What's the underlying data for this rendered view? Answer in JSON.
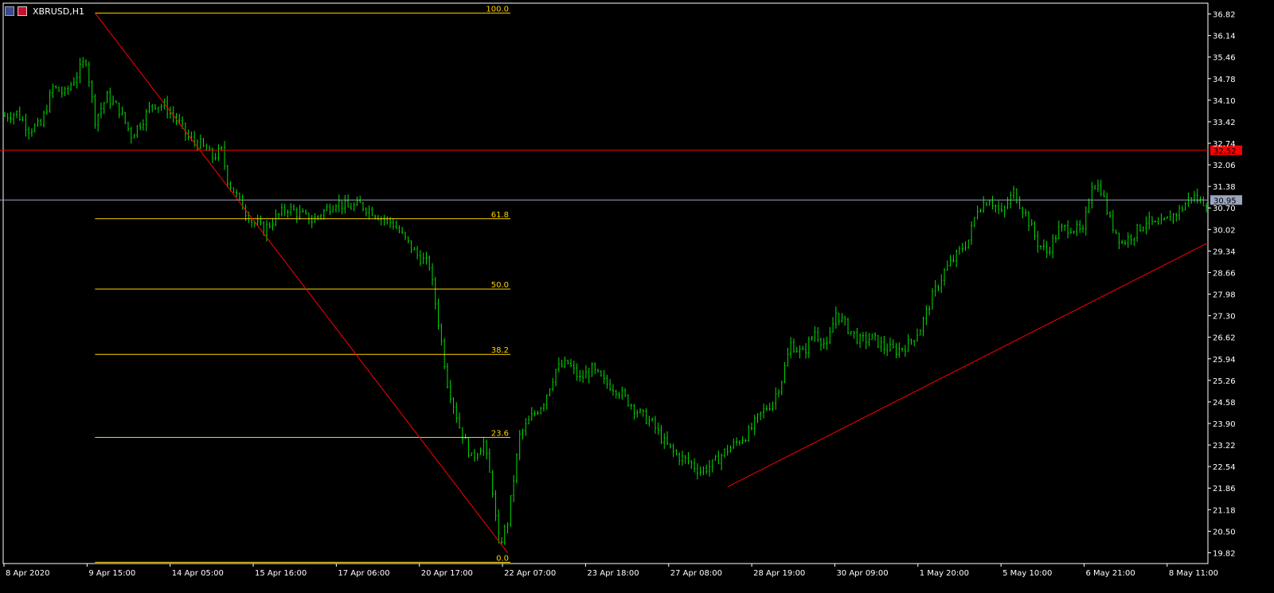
{
  "window": {
    "symbol_title": "XBRUSD,H1",
    "icons": [
      "window-menu-icon",
      "flag-icon"
    ]
  },
  "colors": {
    "background": "#000000",
    "candle": "#00e000",
    "fib_level": "#ffd400",
    "trendline": "#ff0000",
    "resistance": "#ff0000",
    "bid_line": "#9aa6c0",
    "axis": "#ffffff"
  },
  "chart_data": {
    "type": "candlestick",
    "symbol": "XBRUSD",
    "timeframe": "H1",
    "ylim": [
      19.48,
      37.16
    ],
    "price_ticks": [
      "36.82",
      "36.14",
      "35.46",
      "34.78",
      "34.10",
      "33.42",
      "32.74",
      "32.06",
      "31.38",
      "30.70",
      "30.02",
      "29.34",
      "28.66",
      "27.98",
      "27.30",
      "26.62",
      "25.94",
      "25.26",
      "24.58",
      "23.90",
      "23.22",
      "22.54",
      "21.86",
      "21.18",
      "20.50",
      "19.82"
    ],
    "time_ticks": [
      "8 Apr 2020",
      "9 Apr 15:00",
      "14 Apr 05:00",
      "15 Apr 16:00",
      "17 Apr 06:00",
      "20 Apr 17:00",
      "22 Apr 07:00",
      "23 Apr 18:00",
      "27 Apr 08:00",
      "28 Apr 19:00",
      "30 Apr 09:00",
      "1 May 20:00",
      "5 May 10:00",
      "6 May 21:00",
      "8 May 11:00"
    ],
    "path": [
      [
        0,
        33.6
      ],
      [
        4,
        33.7
      ],
      [
        8,
        33.2
      ],
      [
        12,
        33.3
      ],
      [
        16,
        34.5
      ],
      [
        20,
        34.3
      ],
      [
        24,
        34.9
      ],
      [
        27,
        35.4
      ],
      [
        30,
        33.5
      ],
      [
        34,
        34.2
      ],
      [
        38,
        33.8
      ],
      [
        42,
        33.0
      ],
      [
        46,
        33.5
      ],
      [
        49,
        34.0
      ],
      [
        53,
        33.9
      ],
      [
        57,
        33.5
      ],
      [
        61,
        32.9
      ],
      [
        65,
        32.7
      ],
      [
        69,
        32.3
      ],
      [
        72,
        32.5
      ],
      [
        74,
        31.6
      ],
      [
        78,
        30.9
      ],
      [
        82,
        30.3
      ],
      [
        86,
        30.0
      ],
      [
        90,
        30.4
      ],
      [
        94,
        30.7
      ],
      [
        98,
        30.5
      ],
      [
        102,
        30.3
      ],
      [
        106,
        30.6
      ],
      [
        110,
        30.9
      ],
      [
        114,
        30.7
      ],
      [
        118,
        30.8
      ],
      [
        122,
        30.6
      ],
      [
        125,
        30.4
      ],
      [
        129,
        30.2
      ],
      [
        133,
        29.7
      ],
      [
        137,
        29.2
      ],
      [
        141,
        28.9
      ],
      [
        144,
        27.1
      ],
      [
        147,
        25.2
      ],
      [
        151,
        23.8
      ],
      [
        155,
        22.8
      ],
      [
        159,
        23.3
      ],
      [
        162,
        21.8
      ],
      [
        164,
        20.0
      ],
      [
        167,
        20.8
      ],
      [
        171,
        23.5
      ],
      [
        175,
        24.1
      ],
      [
        179,
        24.6
      ],
      [
        183,
        25.6
      ],
      [
        187,
        25.8
      ],
      [
        191,
        25.3
      ],
      [
        195,
        25.6
      ],
      [
        199,
        25.2
      ],
      [
        203,
        25.0
      ],
      [
        207,
        24.6
      ],
      [
        211,
        24.2
      ],
      [
        215,
        23.9
      ],
      [
        219,
        23.3
      ],
      [
        223,
        22.9
      ],
      [
        227,
        22.7
      ],
      [
        231,
        22.4
      ],
      [
        235,
        22.6
      ],
      [
        239,
        23.0
      ],
      [
        243,
        23.3
      ],
      [
        247,
        23.6
      ],
      [
        251,
        24.2
      ],
      [
        255,
        24.6
      ],
      [
        258,
        25.3
      ],
      [
        261,
        26.4
      ],
      [
        265,
        26.1
      ],
      [
        269,
        26.8
      ],
      [
        273,
        26.3
      ],
      [
        276,
        27.4
      ],
      [
        280,
        26.9
      ],
      [
        284,
        26.5
      ],
      [
        288,
        26.6
      ],
      [
        292,
        26.3
      ],
      [
        296,
        26.2
      ],
      [
        300,
        26.4
      ],
      [
        304,
        26.9
      ],
      [
        308,
        27.9
      ],
      [
        312,
        28.7
      ],
      [
        316,
        29.2
      ],
      [
        320,
        29.7
      ],
      [
        323,
        30.7
      ],
      [
        327,
        31.0
      ],
      [
        331,
        30.5
      ],
      [
        335,
        31.2
      ],
      [
        339,
        30.5
      ],
      [
        343,
        29.6
      ],
      [
        346,
        29.3
      ],
      [
        350,
        30.0
      ],
      [
        354,
        30.1
      ],
      [
        358,
        29.9
      ],
      [
        361,
        31.5
      ],
      [
        364,
        31.3
      ],
      [
        367,
        30.3
      ],
      [
        371,
        29.6
      ],
      [
        375,
        29.9
      ],
      [
        379,
        30.3
      ],
      [
        383,
        30.1
      ],
      [
        387,
        30.4
      ],
      [
        391,
        30.7
      ],
      [
        394,
        31.1
      ],
      [
        397,
        30.9
      ]
    ],
    "fibonacci": {
      "levels": [
        {
          "label": "100.0",
          "price": 36.85
        },
        {
          "label": "61.8",
          "price": 30.36
        },
        {
          "label": "50.0",
          "price": 28.14
        },
        {
          "label": "38.2",
          "price": 26.08
        },
        {
          "label": "23.6",
          "price": 23.46
        },
        {
          "label": "0.0",
          "price": 19.52
        }
      ],
      "start_time_index": 30,
      "end_time_index": 167
    },
    "trendlines": [
      {
        "from": [
          30,
          36.85
        ],
        "to": [
          167,
          19.82
        ]
      },
      {
        "from": [
          240,
          21.9
        ],
        "to": [
          400,
          29.6
        ]
      }
    ],
    "horizontal_lines": [
      {
        "role": "resistance",
        "price": 32.52,
        "tag": "32.52"
      },
      {
        "role": "bid",
        "price": 30.95,
        "tag": "30.95"
      }
    ]
  }
}
